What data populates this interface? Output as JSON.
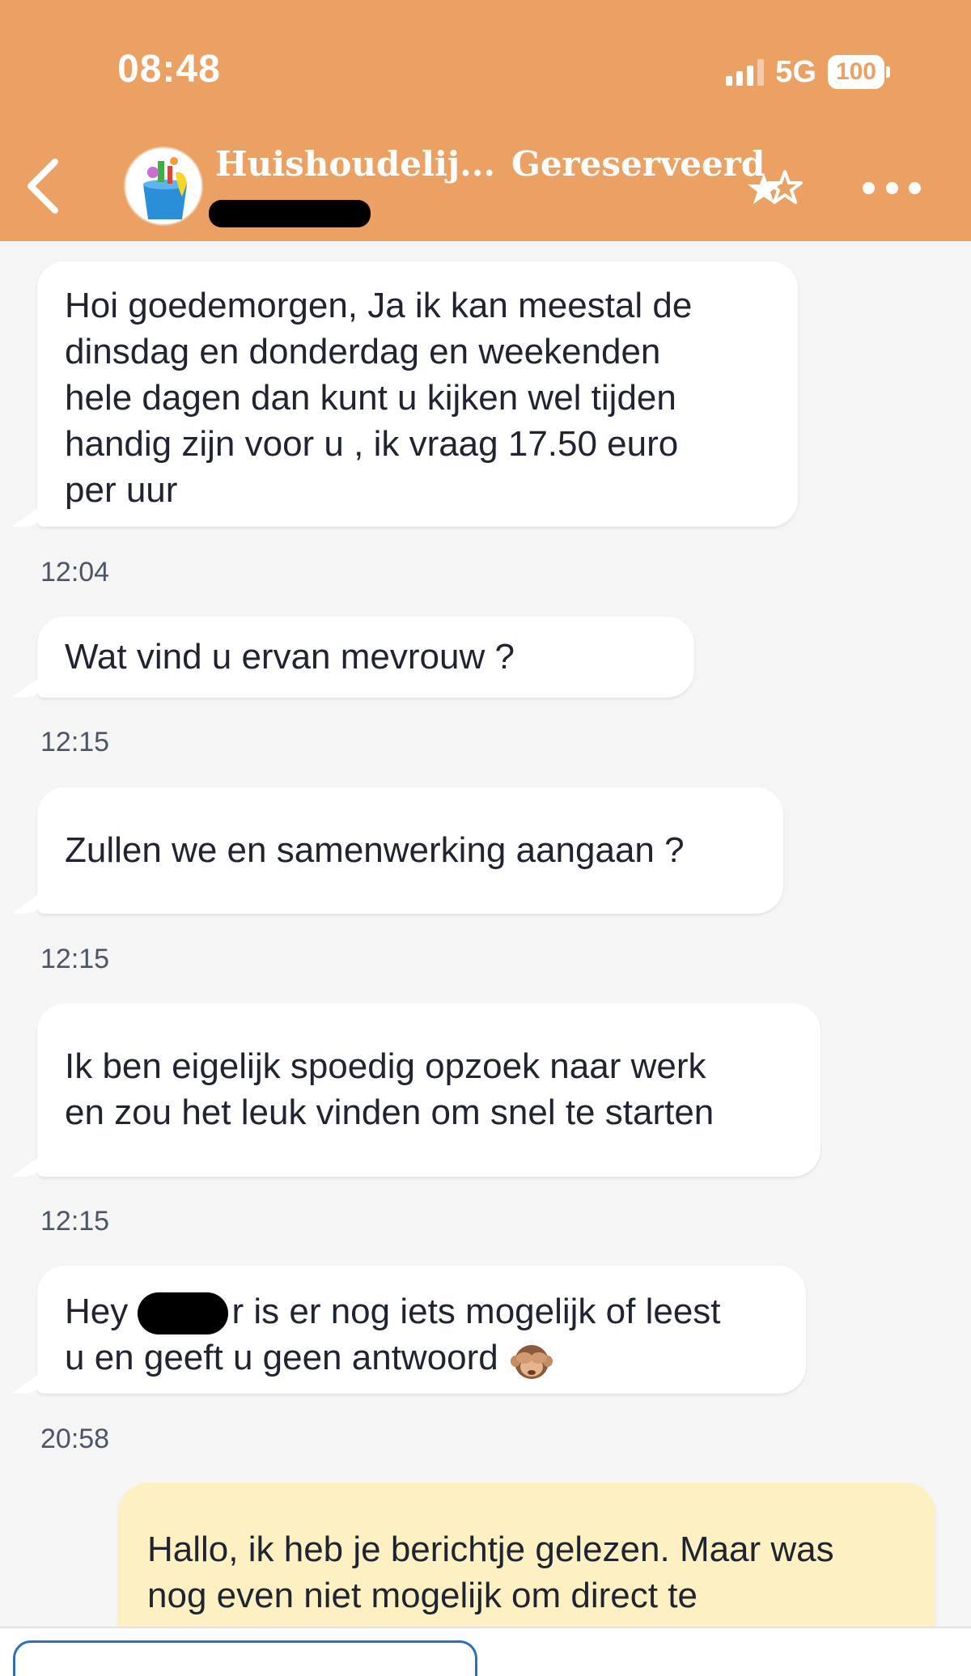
{
  "status_bar": {
    "time": "08:48",
    "network": "5G",
    "battery": "100"
  },
  "header": {
    "title": "Huishoudelij...",
    "status": "Gereserveerd",
    "colors": {
      "background": "#eba164",
      "text": "#ffffff"
    },
    "icons": {
      "back": "chevron-left-icon",
      "favorite": "star-icon",
      "more": "more-icon"
    }
  },
  "messages": [
    {
      "direction": "incoming",
      "lines": [
        "Hoi goedemorgen, Ja ik kan meestal de",
        "dinsdag en donderdag en weekenden",
        "hele dagen dan kunt u kijken wel tijden",
        "handig zijn voor u , ik vraag 17.50 euro",
        "per uur"
      ],
      "time": "12:04"
    },
    {
      "direction": "incoming",
      "lines": [
        "Wat vind u ervan mevrouw ?"
      ],
      "time": "12:15"
    },
    {
      "direction": "incoming",
      "lines": [
        "Zullen we en samenwerking aangaan ?"
      ],
      "time": "12:15"
    },
    {
      "direction": "incoming",
      "lines": [
        "Ik ben eigelijk spoedig opzoek naar werk",
        "en zou het leuk vinden om snel te starten"
      ],
      "time": "12:15"
    },
    {
      "direction": "incoming",
      "line1_start": "Hey",
      "line1_end": "r is er nog iets mogelijk of leest",
      "line2": "u en geeft u geen antwoord",
      "emoji": "see-no-evil-monkey-icon",
      "time": "20:58"
    },
    {
      "direction": "outgoing",
      "lines": [
        "Hallo, ik heb je berichtje gelezen. Maar was",
        "nog even niet mogelijk om direct te"
      ],
      "color": "#fdf0c3"
    }
  ]
}
